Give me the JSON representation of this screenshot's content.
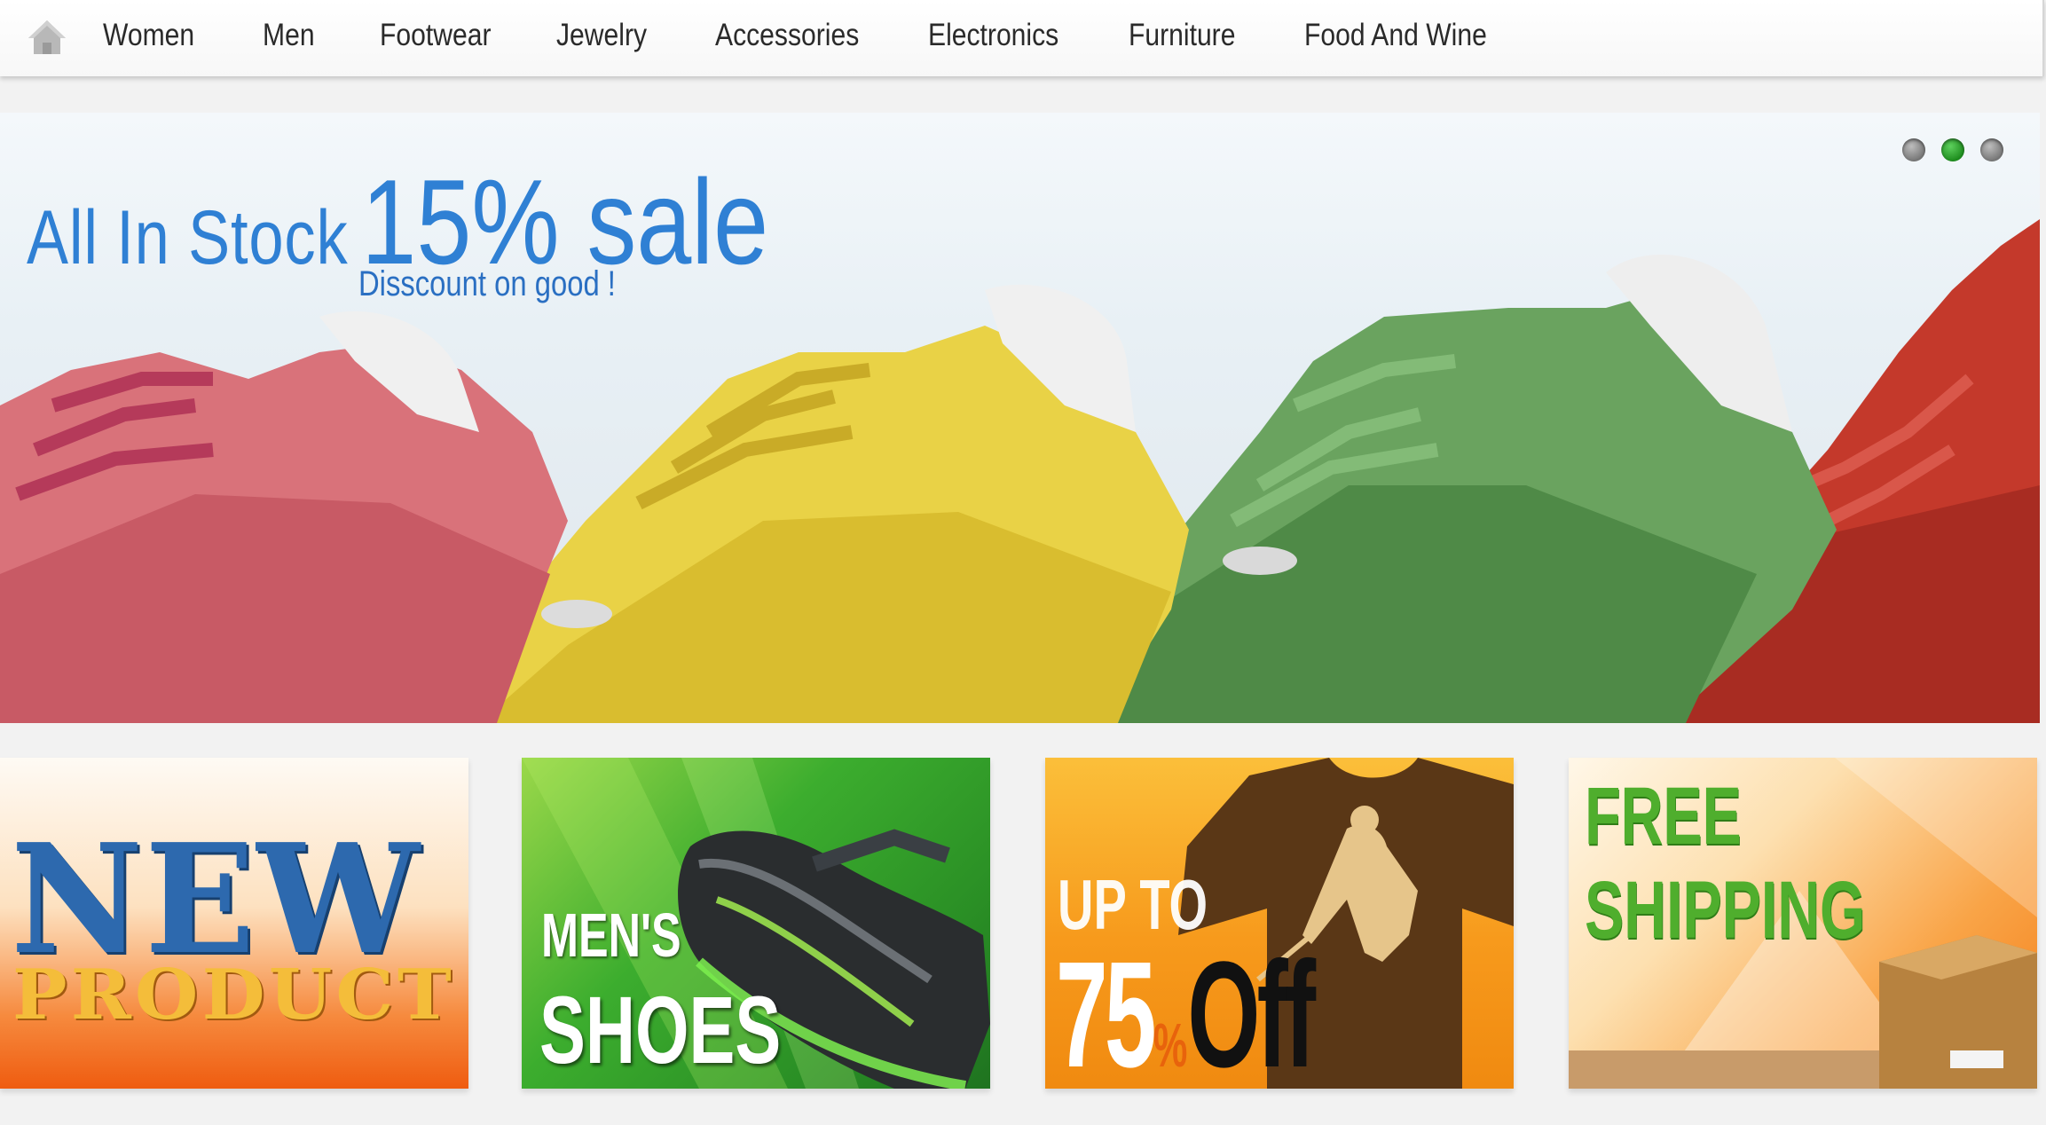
{
  "nav": {
    "home_icon": "home-icon",
    "items": [
      "Women",
      "Men",
      "Footwear",
      "Jewelry",
      "Accessories",
      "Electronics",
      "Furniture",
      "Food And Wine"
    ]
  },
  "hero": {
    "title_small": "All In Stock",
    "title_big": "15% sale",
    "subtitle": "Disscount on good !",
    "slides_total": 3,
    "active_slide": 2,
    "colors": {
      "title": "#2f80d4",
      "dot_active": "#1e8d1e",
      "dot_inactive": "#8a8a8a"
    }
  },
  "promos": {
    "new_product": {
      "line1": "NEW",
      "line2": "PRODUCT"
    },
    "mens_shoes": {
      "line1": "MEN'S",
      "line2": "SHOES"
    },
    "discount": {
      "line1": "UP TO",
      "number": "75",
      "percent": "%",
      "word": "Off"
    },
    "shipping": {
      "line1": "FREE",
      "line2": "SHIPPING"
    }
  }
}
